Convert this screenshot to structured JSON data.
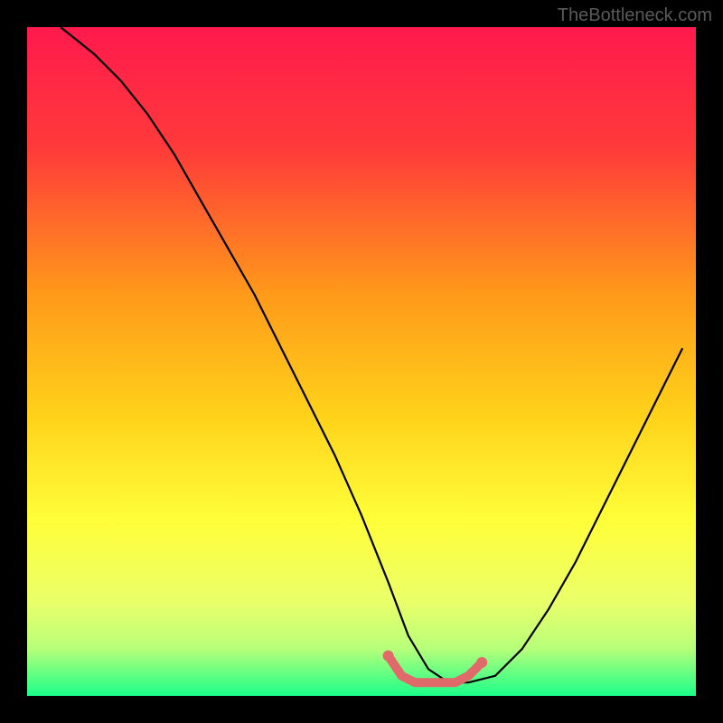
{
  "watermark": "TheBottleneck.com",
  "chart_data": {
    "type": "line",
    "title": "",
    "xlabel": "",
    "ylabel": "",
    "xlim": [
      0,
      100
    ],
    "ylim": [
      0,
      100
    ],
    "background": {
      "type": "vertical-gradient",
      "stops": [
        {
          "offset": 0,
          "color": "#ff1a4d"
        },
        {
          "offset": 18,
          "color": "#ff3a3a"
        },
        {
          "offset": 40,
          "color": "#ff9a1a"
        },
        {
          "offset": 58,
          "color": "#ffd21a"
        },
        {
          "offset": 74,
          "color": "#ffff3a"
        },
        {
          "offset": 86,
          "color": "#eaff6a"
        },
        {
          "offset": 93,
          "color": "#b6ff7a"
        },
        {
          "offset": 100,
          "color": "#1aff8a"
        }
      ]
    },
    "series": [
      {
        "name": "bottleneck-curve",
        "color": "#000000",
        "x": [
          5,
          10,
          14,
          18,
          22,
          26,
          30,
          34,
          38,
          42,
          46,
          50,
          54,
          57,
          60,
          63,
          66,
          70,
          74,
          78,
          82,
          86,
          90,
          94,
          98
        ],
        "y": [
          100,
          96,
          92,
          87,
          81,
          74,
          67,
          60,
          52,
          44,
          36,
          27,
          17,
          9,
          4,
          2,
          2,
          3,
          7,
          13,
          20,
          28,
          36,
          44,
          52
        ]
      }
    ],
    "highlight": {
      "name": "optimal-range",
      "color": "#e06a6a",
      "x": [
        54,
        56,
        58,
        60,
        62,
        64,
        66,
        68
      ],
      "y": [
        6,
        3,
        2,
        2,
        2,
        2,
        3,
        5
      ]
    }
  }
}
